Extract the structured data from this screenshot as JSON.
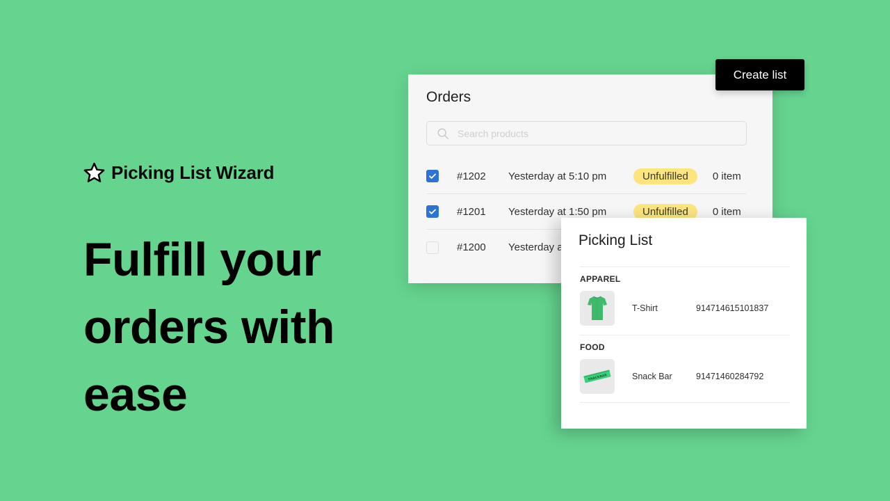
{
  "brand": {
    "name": "Picking List Wizard",
    "icon": "star-outline-icon"
  },
  "headline": "Fulfill your orders with ease",
  "orders": {
    "title": "Orders",
    "search": {
      "placeholder": "Search products",
      "value": "",
      "icon": "search-icon"
    },
    "rows": [
      {
        "checked": true,
        "id": "#1202",
        "time": "Yesterday at 5:10 pm",
        "status": "Unfulfilled",
        "items": "0 item"
      },
      {
        "checked": true,
        "id": "#1201",
        "time": "Yesterday at 1:50 pm",
        "status": "Unfulfilled",
        "items": "0 item"
      },
      {
        "checked": false,
        "id": "#1200",
        "time": "Yesterday at",
        "status": "",
        "items": ""
      }
    ]
  },
  "toolbar": {
    "create_label": "Create list"
  },
  "picking_list": {
    "title": "Picking List",
    "categories": [
      {
        "name": "APPAREL",
        "items": [
          {
            "name": "T-Shirt",
            "sku": "914714615101837",
            "image": "green-tshirt"
          }
        ]
      },
      {
        "name": "FOOD",
        "items": [
          {
            "name": "Snack Bar",
            "sku": "91471460284792",
            "image": "green-snack-bar"
          }
        ]
      }
    ]
  },
  "colors": {
    "background": "#65d48f",
    "checkbox_accent": "#2f72d6",
    "badge_unfulfilled": "#fce47e",
    "button_primary": "#000000"
  }
}
